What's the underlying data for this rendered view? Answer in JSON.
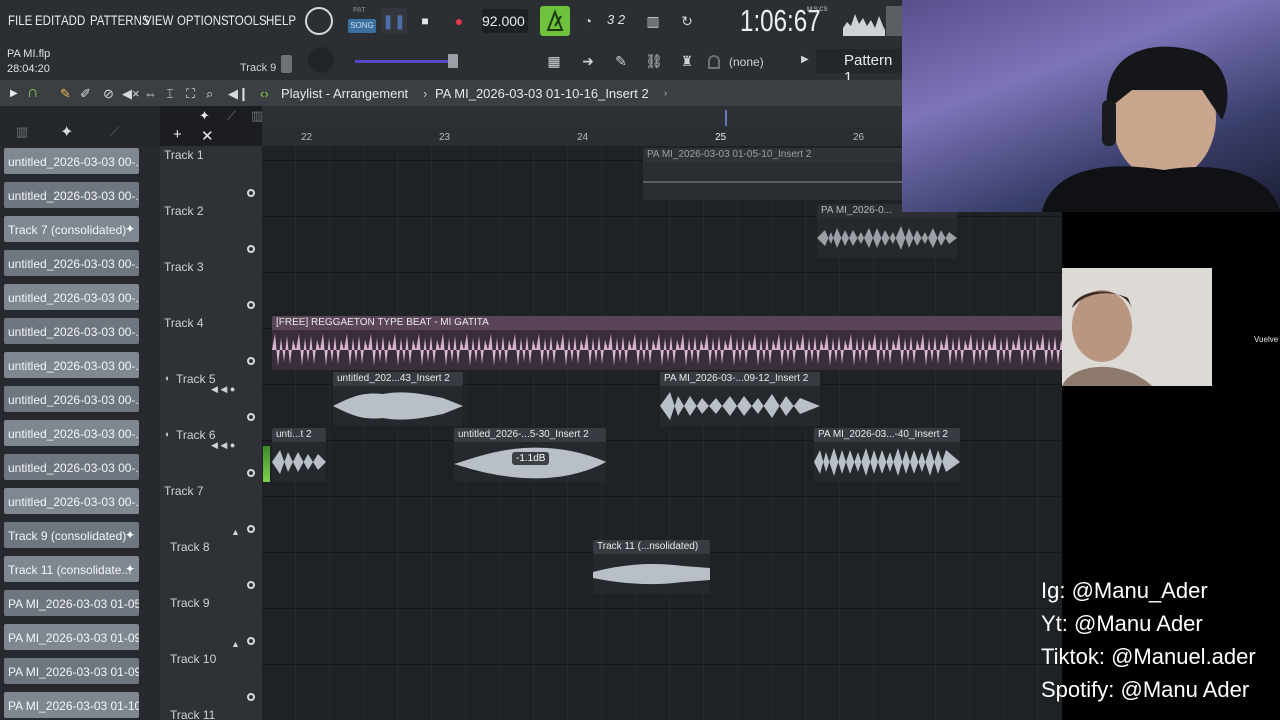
{
  "menu": {
    "items": [
      "FILE",
      "EDIT",
      "ADD",
      "PATTERNS",
      "VIEW",
      "OPTIONS",
      "TOOLS",
      "HELP"
    ]
  },
  "transport": {
    "pat_label": "PAT",
    "song_label": "SONG",
    "tempo": "92.000",
    "time_display": "1:06:67",
    "time_unit": "M:S:CS",
    "step_label": "3 2"
  },
  "project": {
    "file_name": "PA MI.flp",
    "time": "28:04:20",
    "hint_track": "Track 9",
    "channel_selector": "(none)",
    "pattern": "Pattern 1"
  },
  "playlist": {
    "title": "Playlist - Arrangement",
    "separator": "›",
    "current_pattern": "PA MI_2026-03-03 01-10-16_Insert 2"
  },
  "ruler": {
    "bars": [
      "22",
      "23",
      "24",
      "25",
      "26"
    ]
  },
  "browser": {
    "items": [
      {
        "label": "untitled_2026-03-03 00-...",
        "plus": false
      },
      {
        "label": "untitled_2026-03-03 00-...",
        "plus": false
      },
      {
        "label": "Track 7 (consolidated)",
        "plus": true
      },
      {
        "label": "untitled_2026-03-03 00-...",
        "plus": false
      },
      {
        "label": "untitled_2026-03-03 00-...",
        "plus": false
      },
      {
        "label": "untitled_2026-03-03 00-...",
        "plus": false
      },
      {
        "label": "untitled_2026-03-03 00-...",
        "plus": false
      },
      {
        "label": "untitled_2026-03-03 00-...",
        "plus": false
      },
      {
        "label": "untitled_2026-03-03 00-...",
        "plus": false
      },
      {
        "label": "untitled_2026-03-03 00-...",
        "plus": false
      },
      {
        "label": "untitled_2026-03-03 00-...",
        "plus": false
      },
      {
        "label": "Track 9 (consolidated)",
        "plus": true
      },
      {
        "label": "Track 11 (consolidate...",
        "plus": true
      },
      {
        "label": "PA MI_2026-03-03 01-05...",
        "plus": false
      },
      {
        "label": "PA MI_2026-03-03 01-09...",
        "plus": false
      },
      {
        "label": "PA MI_2026-03-03 01-09...",
        "plus": false
      },
      {
        "label": "PA MI_2026-03-03 01-10...",
        "plus": false
      }
    ]
  },
  "tracks": [
    "Track 1",
    "Track 2",
    "Track 3",
    "Track 4",
    "Track 5",
    "Track 6",
    "Track 7",
    "Track 8",
    "Track 9",
    "Track 10",
    "Track 11"
  ],
  "clips": {
    "c1": "PA MI_2026-03-03 01-05-10_Insert 2",
    "c2": "PA MI_2026-0...",
    "c4": "[FREE] REGGAETON TYPE BEAT - MI GATITA",
    "c5a": "untitled_202...43_Insert 2",
    "c5b": "PA MI_2026-03-...09-12_Insert 2",
    "c6a": "unti...t 2",
    "c6b": "untitled_2026-...5-30_Insert 2",
    "c6b_gain": "-1.1dB",
    "c6c": "PA MI_2026-03...-40_Insert 2",
    "c8": "Track 11 (...nsolidated)"
  },
  "overlay": {
    "vuelve": "Vuelve",
    "social": [
      "Ig: @Manu_Ader",
      "Yt: @Manu Ader",
      "Tiktok: @Manuel.ader",
      "Spotify: @Manu Ader"
    ]
  },
  "colors": {
    "beat_clip": "#d9b3d1",
    "audio_clip": "#b8bfc6",
    "accent_green": "#6ec23c",
    "record_red": "#e03b4a"
  }
}
